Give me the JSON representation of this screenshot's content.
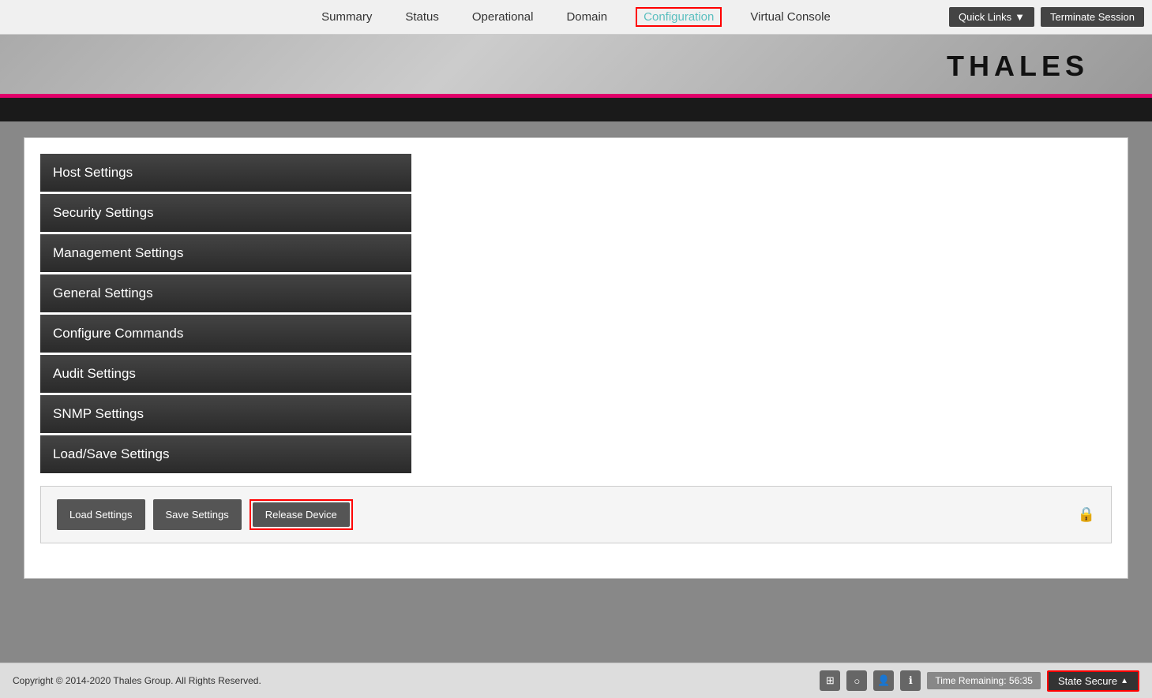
{
  "nav": {
    "items": [
      {
        "label": "Summary",
        "active": false
      },
      {
        "label": "Status",
        "active": false
      },
      {
        "label": "Operational",
        "active": false
      },
      {
        "label": "Domain",
        "active": false
      },
      {
        "label": "Configuration",
        "active": true
      },
      {
        "label": "Virtual Console",
        "active": false
      }
    ],
    "quick_links_label": "Quick Links",
    "terminate_session_label": "Terminate Session"
  },
  "header": {
    "logo": "THALES"
  },
  "sidebar": {
    "items": [
      {
        "label": "Host Settings"
      },
      {
        "label": "Security Settings"
      },
      {
        "label": "Management Settings"
      },
      {
        "label": "General Settings"
      },
      {
        "label": "Configure Commands"
      },
      {
        "label": "Audit Settings"
      },
      {
        "label": "SNMP Settings"
      },
      {
        "label": "Load/Save Settings"
      }
    ]
  },
  "actions": {
    "load_settings": "Load Settings",
    "save_settings": "Save Settings",
    "release_device": "Release Device"
  },
  "footer": {
    "copyright": "Copyright © 2014-2020 Thales Group. All Rights Reserved.",
    "time_remaining_label": "Time Remaining: 56:35",
    "state_secure_label": "State Secure"
  }
}
